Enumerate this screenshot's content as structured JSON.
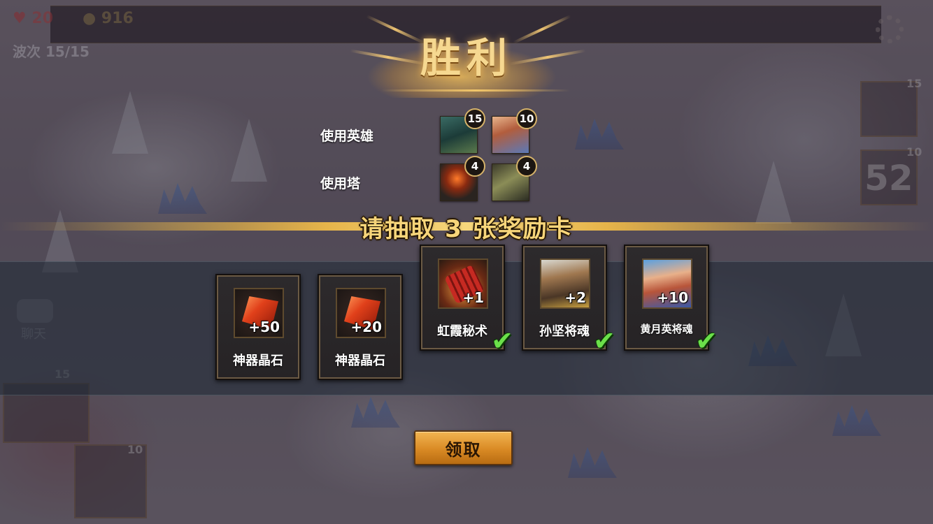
{
  "hud": {
    "life": "20",
    "gold": "916",
    "wave": "波次 15/15",
    "side_count_top": "15",
    "side_count_mid": "10",
    "side_timer": "52",
    "bottom_count_a": "15",
    "bottom_count_b": "10",
    "chat_label": "聊天"
  },
  "victory": {
    "title": "胜利",
    "used_heroes_label": "使用英雄",
    "used_towers_label": "使用塔",
    "heroes": [
      {
        "icon": "hero-dragon-warrior-icon",
        "level": "15"
      },
      {
        "icon": "hero-female-warrior-icon",
        "level": "10"
      }
    ],
    "towers": [
      {
        "icon": "fire-tower-icon",
        "level": "4"
      },
      {
        "icon": "crossbow-tower-icon",
        "level": "4"
      }
    ]
  },
  "banner": {
    "text": "请抽取 3 张奖励卡"
  },
  "rewards": [
    {
      "name": "神器晶石",
      "amount": "+50",
      "icon": "artifact-crystal-icon",
      "selected": false
    },
    {
      "name": "神器晶石",
      "amount": "+20",
      "icon": "artifact-crystal-icon",
      "selected": false
    },
    {
      "name": "虹霞秘术",
      "amount": "+1",
      "icon": "secret-scroll-icon",
      "selected": true
    },
    {
      "name": "孙坚将魂",
      "amount": "+2",
      "icon": "sunjian-portrait-icon",
      "selected": true
    },
    {
      "name": "黄月英将魂",
      "amount": "+10",
      "icon": "huangyueying-portrait-icon",
      "selected": true
    }
  ],
  "claim_button": {
    "label": "领取"
  },
  "colors": {
    "gold_text": "#f7d57a",
    "check_green": "#6be04a",
    "button_orange": "#d98a24"
  }
}
